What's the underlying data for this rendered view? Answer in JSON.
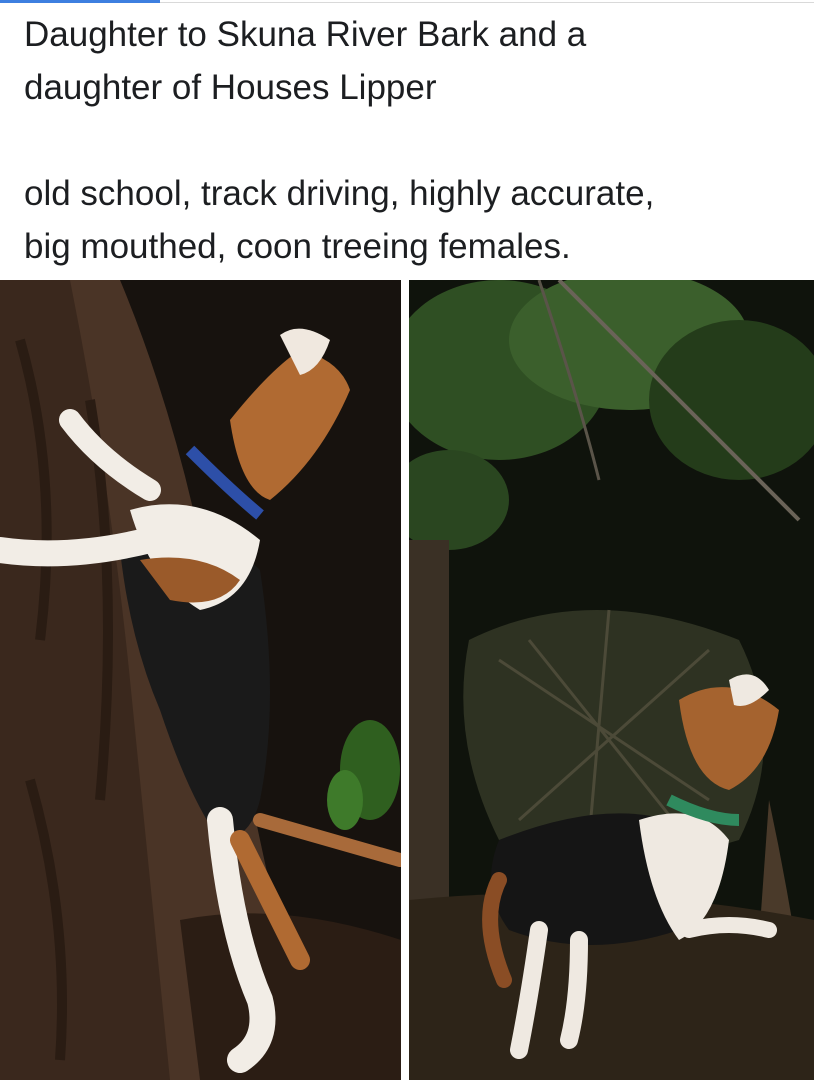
{
  "post": {
    "line1": "Daughter to Skuna River Bark and a",
    "line2": "daughter of Houses Lipper",
    "line3": "old school, track driving, highly accurate,",
    "line4": "big mouthed, coon treeing females."
  },
  "colors": {
    "text": "#1c1e21",
    "progress": "#3d7fe0",
    "background": "#ffffff"
  },
  "photos": {
    "left": "photo-hound-treeing-left",
    "right": "photo-hound-treeing-right"
  }
}
